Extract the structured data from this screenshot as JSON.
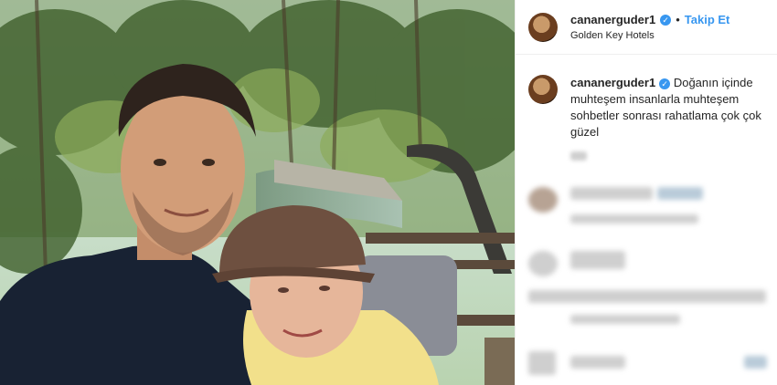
{
  "post": {
    "username": "cananerguder1",
    "verified_icon": "verified-badge-icon",
    "follow_label": "Takip Et",
    "separator": "•",
    "location": "Golden Key Hotels",
    "caption": "Doğanın içinde muhteşem insanlarla muhteşem sohbetler sonrası rahatlama çok çok güzel"
  },
  "colors": {
    "accent": "#3897f0",
    "text": "#262626",
    "border": "#efefef"
  }
}
